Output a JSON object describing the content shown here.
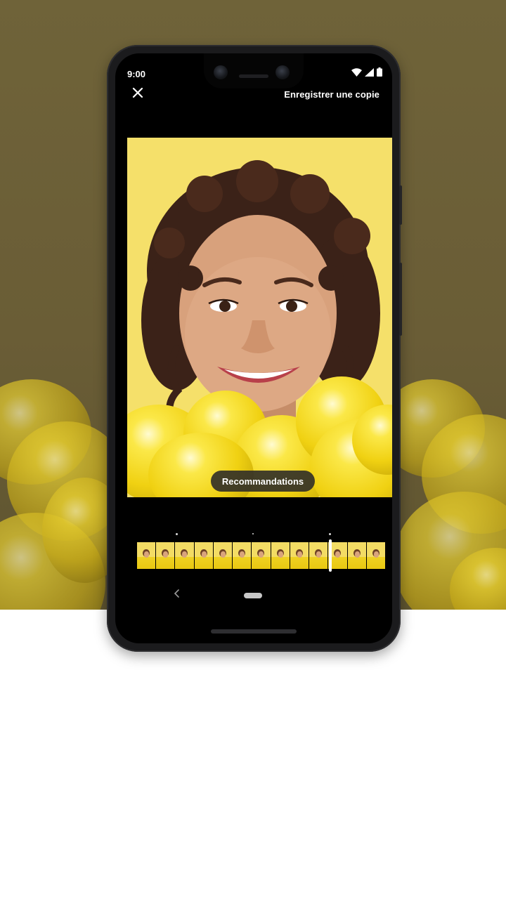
{
  "status_bar": {
    "time": "9:00"
  },
  "toolbar": {
    "save_copy_label": "Enregistrer une copie"
  },
  "photo": {
    "suggestion_chip": "Recommandations"
  },
  "icons": {
    "close": "close-icon",
    "wifi": "wifi-icon",
    "signal": "cell-signal-icon",
    "battery": "battery-icon",
    "back": "nav-back-icon",
    "home": "nav-home-icon"
  },
  "colors": {
    "background": "#6a5d36",
    "photo_background": "#f5e06a",
    "balloon_yellow": "#f0d112",
    "chip_background": "#302e28"
  }
}
